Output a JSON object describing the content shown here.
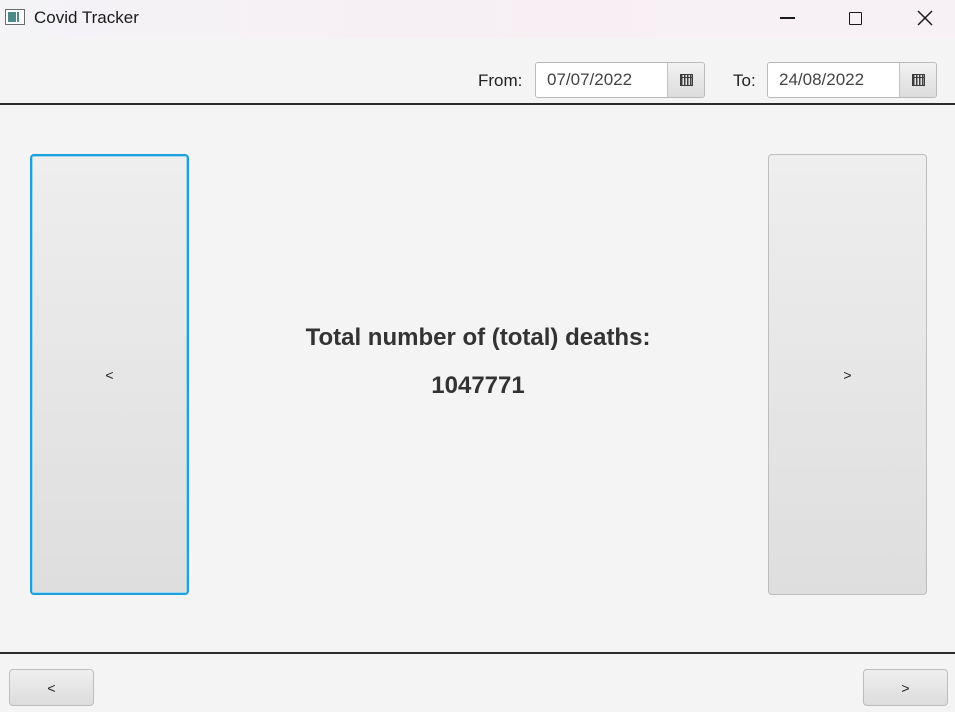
{
  "window": {
    "title": "Covid Tracker",
    "icon": "app-window-icon"
  },
  "filters": {
    "from_label": "From:",
    "from_value": "07/07/2022",
    "to_label": "To:",
    "to_value": "24/08/2022",
    "calendar_icon": "calendar-icon"
  },
  "main": {
    "prev_label": "<",
    "next_label": ">",
    "headline": "Total number of (total) deaths:",
    "value": "1047771"
  },
  "footer": {
    "prev_label": "<",
    "next_label": ">"
  },
  "colors": {
    "focus_border": "#1aa0dc",
    "separator": "#2c2c2c",
    "background": "#f4f4f4"
  }
}
